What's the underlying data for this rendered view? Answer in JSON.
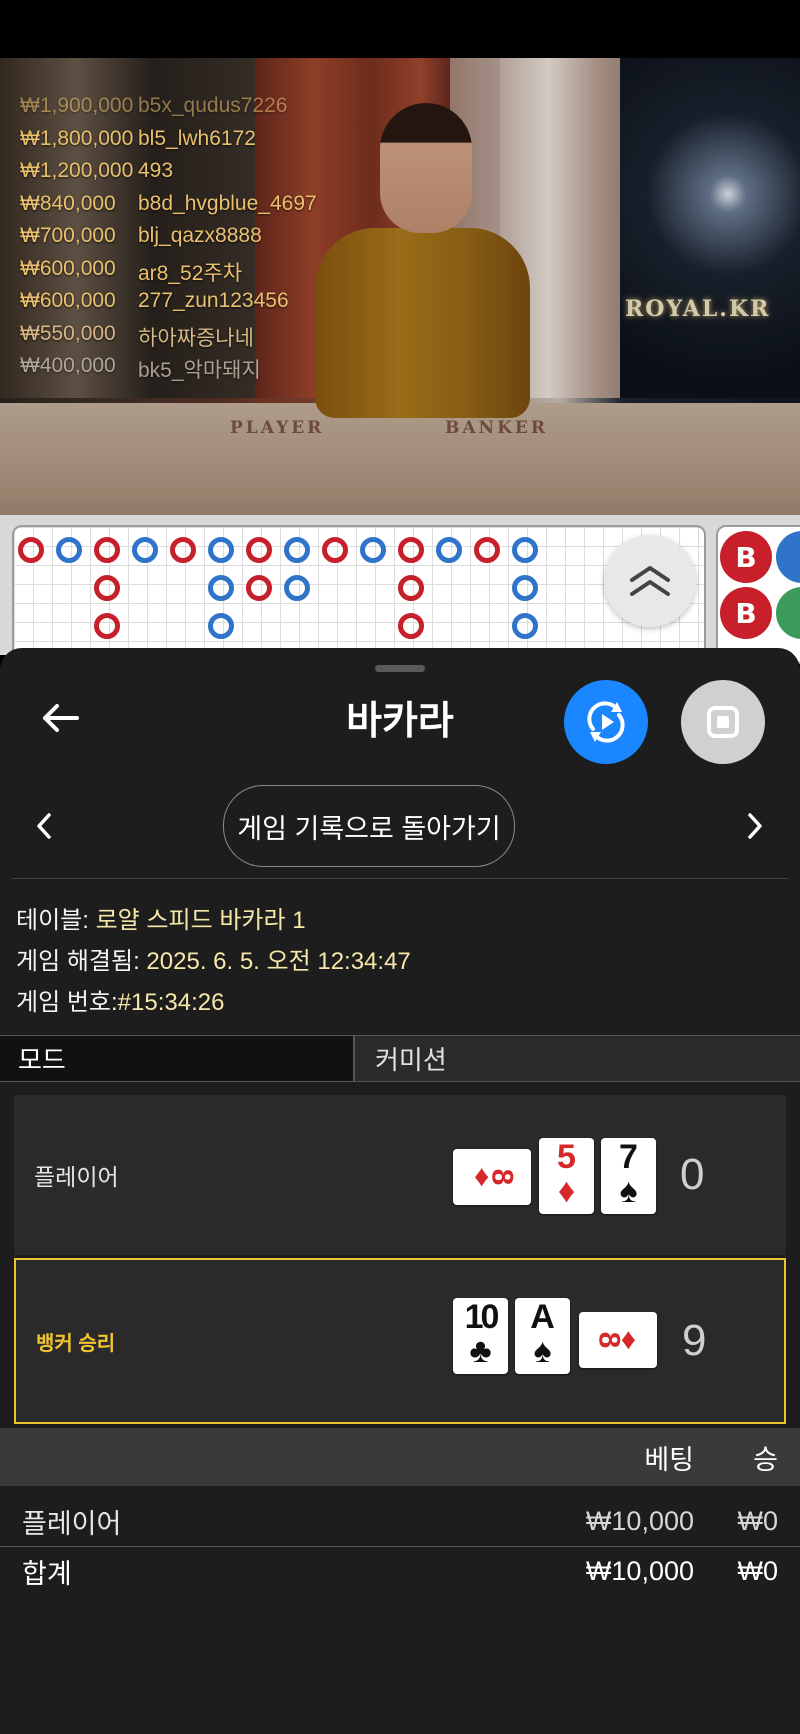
{
  "live_video": {
    "recent_wins": [
      {
        "amount": "₩1,900,000",
        "user": "b5x_qudus7226"
      },
      {
        "amount": "₩1,800,000",
        "user": "bl5_lwh6172"
      },
      {
        "amount": "₩1,200,000",
        "user": "493"
      },
      {
        "amount": "₩840,000",
        "user": "b8d_hvgblue_4697"
      },
      {
        "amount": "₩700,000",
        "user": "blj_qazx8888"
      },
      {
        "amount": "₩600,000",
        "user": "ar8_52주차"
      },
      {
        "amount": "₩600,000",
        "user": "277_zun123456"
      },
      {
        "amount": "₩550,000",
        "user": "하아짜증나네"
      },
      {
        "amount": "₩400,000",
        "user": "bk5_악마돼지"
      }
    ],
    "studio_logo": "ROYAL.KR",
    "table_player_label": "PLAYER",
    "table_banker_label": "BANKER"
  },
  "roadmap": {
    "bead_letters": [
      "B",
      "B"
    ]
  },
  "header": {
    "title": "바카라",
    "back_icon": "arrow-left-icon",
    "replay_icon": "replay-icon",
    "stop_icon": "stop-icon"
  },
  "history_nav": {
    "label": "게임 기록으로 돌아가기"
  },
  "game_info": {
    "table_label": "테이블:",
    "table_value": "로얄 스피드 바카라 1",
    "resolved_label": "게임 해결됨:",
    "resolved_value": "2025. 6. 5. 오전 12:34:47",
    "number_label": "게임 번호:",
    "number_value": "#15:34:26"
  },
  "mode": {
    "key": "모드",
    "value": "커미션"
  },
  "hands": {
    "player": {
      "label": "플레이어",
      "total": "0",
      "cards": [
        {
          "rank": "8",
          "suit": "♦",
          "color": "red",
          "sideways": true
        },
        {
          "rank": "5",
          "suit": "♦",
          "color": "red",
          "sideways": false
        },
        {
          "rank": "7",
          "suit": "♠",
          "color": "black",
          "sideways": false
        }
      ]
    },
    "banker": {
      "label": "뱅커 승리",
      "total": "9",
      "cards": [
        {
          "rank": "10",
          "suit": "♣",
          "color": "black",
          "sideways": false
        },
        {
          "rank": "A",
          "suit": "♠",
          "color": "black",
          "sideways": false
        },
        {
          "rank": "8",
          "suit": "♦",
          "color": "red",
          "sideways": true
        }
      ]
    }
  },
  "bets": {
    "header_bet": "베팅",
    "header_win": "승",
    "rows": [
      {
        "name": "플레이어",
        "bet": "₩10,000",
        "win": "₩0"
      }
    ],
    "total": {
      "name": "합계",
      "bet": "₩10,000",
      "win": "₩0"
    }
  },
  "colors": {
    "accent_blue": "#1a86ff",
    "win_highlight": "#e9c52a",
    "info_value": "#f7e7a9"
  }
}
